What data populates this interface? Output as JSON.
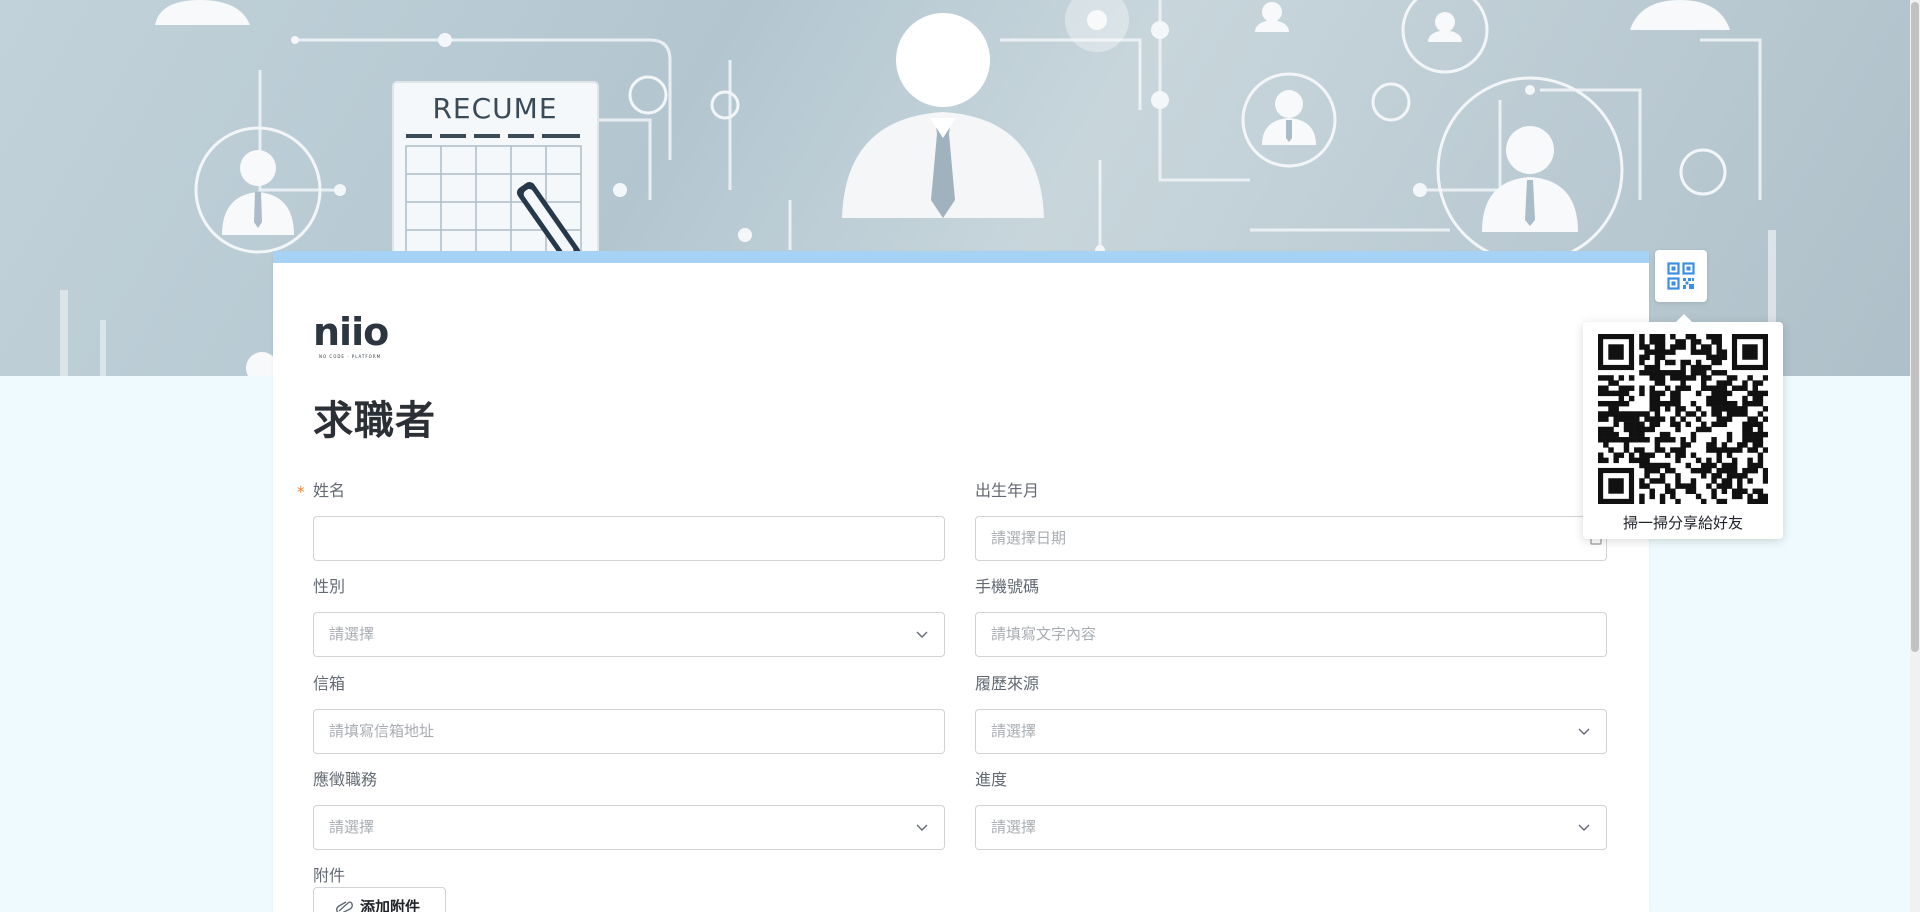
{
  "banner": {
    "resume_text": "RECUME"
  },
  "brand": {
    "name": "niio",
    "tagline": "NO CODE · PLATFORM"
  },
  "form": {
    "title": "求職者",
    "fields": {
      "name": {
        "label": "姓名",
        "required_mark": "*",
        "value": ""
      },
      "birth": {
        "label": "出生年月",
        "placeholder": "請選擇日期"
      },
      "gender": {
        "label": "性別",
        "placeholder": "請選擇"
      },
      "phone": {
        "label": "手機號碼",
        "placeholder": "請填寫文字內容"
      },
      "email": {
        "label": "信箱",
        "placeholder": "請填寫信箱地址"
      },
      "source": {
        "label": "履歷來源",
        "placeholder": "請選擇"
      },
      "position": {
        "label": "應徵職務",
        "placeholder": "請選擇"
      },
      "progress": {
        "label": "進度",
        "placeholder": "請選擇"
      },
      "attachment": {
        "label": "附件",
        "button_label": "添加附件"
      }
    }
  },
  "share": {
    "caption": "掃一掃分享給好友"
  },
  "colors": {
    "accent": "#a6d2f5",
    "page_bg": "#eefafd",
    "qr_icon": "#3b8ee6",
    "required": "#f5812a"
  }
}
